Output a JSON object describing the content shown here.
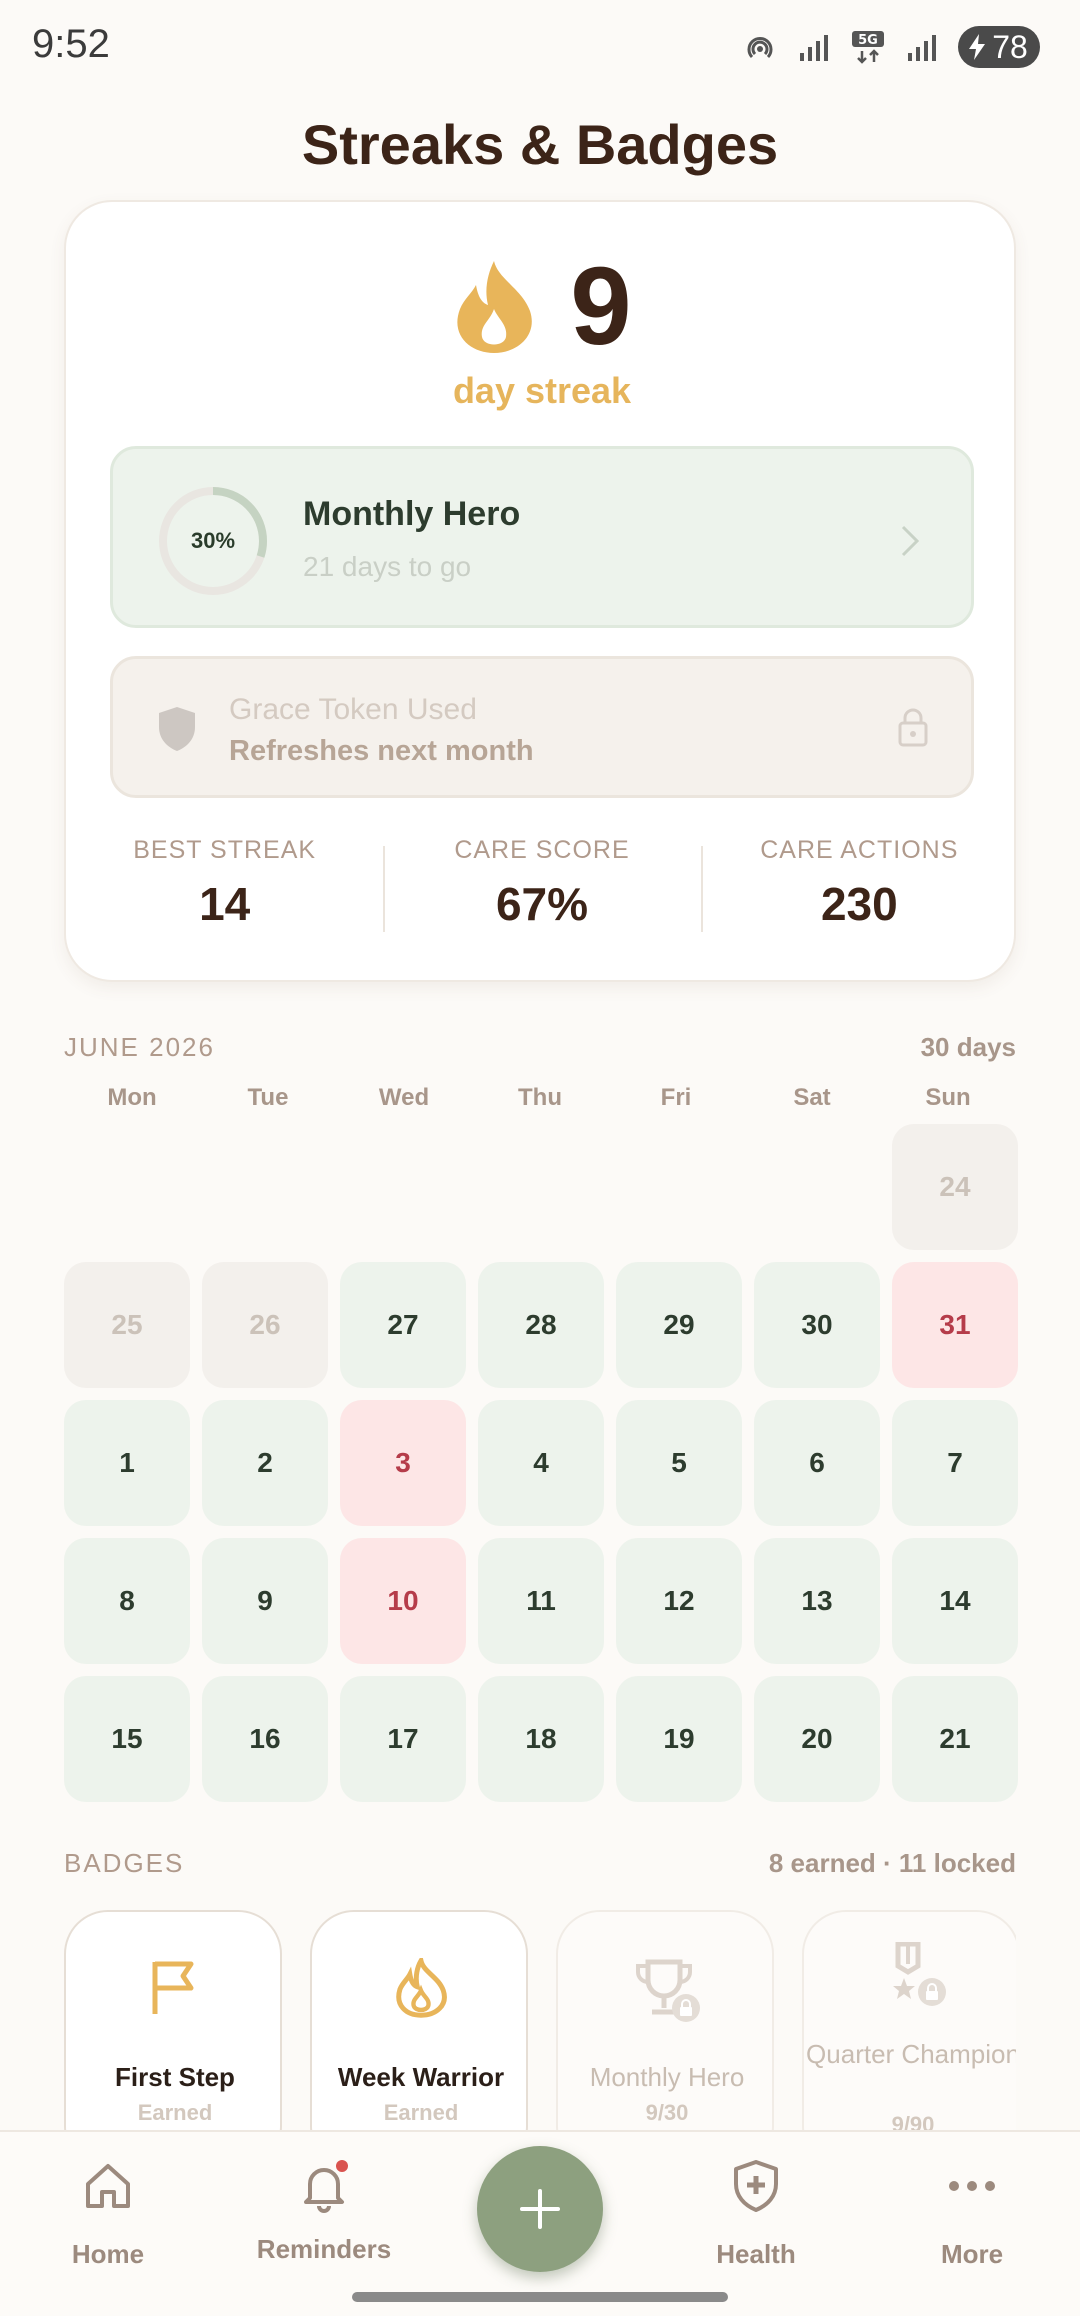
{
  "status_bar": {
    "time": "9:52",
    "battery": "78",
    "network_label": "5G"
  },
  "header": {
    "title": "Streaks & Badges"
  },
  "streak": {
    "value": "9",
    "label": "day streak",
    "flame_color": "#e8b55a"
  },
  "goal": {
    "progress_text": "30%",
    "progress": 0.3,
    "title": "Monthly Hero",
    "subtitle": "21 days to go"
  },
  "grace": {
    "title": "Grace Token Used",
    "subtitle": "Refreshes next month"
  },
  "stats": [
    {
      "label": "BEST STREAK",
      "value": "14"
    },
    {
      "label": "CARE SCORE",
      "value": "67%"
    },
    {
      "label": "CARE ACTIONS",
      "value": "230"
    }
  ],
  "calendar": {
    "month": "JUNE 2026",
    "days_count": "30 days",
    "weekdays": [
      "Mon",
      "Tue",
      "Wed",
      "Thu",
      "Fri",
      "Sat",
      "Sun"
    ],
    "days": [
      {
        "n": "",
        "s": "empty"
      },
      {
        "n": "",
        "s": "empty"
      },
      {
        "n": "",
        "s": "empty"
      },
      {
        "n": "",
        "s": "empty"
      },
      {
        "n": "",
        "s": "empty"
      },
      {
        "n": "",
        "s": "empty"
      },
      {
        "n": "24",
        "s": "future"
      },
      {
        "n": "25",
        "s": "future"
      },
      {
        "n": "26",
        "s": "future"
      },
      {
        "n": "27",
        "s": "done"
      },
      {
        "n": "28",
        "s": "done"
      },
      {
        "n": "29",
        "s": "done"
      },
      {
        "n": "30",
        "s": "done"
      },
      {
        "n": "31",
        "s": "missed"
      },
      {
        "n": "1",
        "s": "done"
      },
      {
        "n": "2",
        "s": "done"
      },
      {
        "n": "3",
        "s": "missed"
      },
      {
        "n": "4",
        "s": "done"
      },
      {
        "n": "5",
        "s": "done"
      },
      {
        "n": "6",
        "s": "done"
      },
      {
        "n": "7",
        "s": "done"
      },
      {
        "n": "8",
        "s": "done"
      },
      {
        "n": "9",
        "s": "done"
      },
      {
        "n": "10",
        "s": "missed"
      },
      {
        "n": "11",
        "s": "done"
      },
      {
        "n": "12",
        "s": "done"
      },
      {
        "n": "13",
        "s": "done"
      },
      {
        "n": "14",
        "s": "done"
      },
      {
        "n": "15",
        "s": "done"
      },
      {
        "n": "16",
        "s": "done"
      },
      {
        "n": "17",
        "s": "done"
      },
      {
        "n": "18",
        "s": "done"
      },
      {
        "n": "19",
        "s": "done"
      },
      {
        "n": "20",
        "s": "done"
      },
      {
        "n": "21",
        "s": "done"
      }
    ]
  },
  "badges": {
    "title": "BADGES",
    "count": "8 earned · 11 locked",
    "items": [
      {
        "name": "First Step",
        "status": "Earned",
        "icon": "flag-icon"
      },
      {
        "name": "Week Warrior",
        "status": "Earned",
        "icon": "flame-icon"
      },
      {
        "name": "Monthly Hero",
        "status": "9/30",
        "icon": "trophy-icon"
      },
      {
        "name": "Quarter Champion",
        "status": "9/90",
        "icon": "medal-icon"
      }
    ]
  },
  "nav": {
    "home": "Home",
    "reminders": "Reminders",
    "health": "Health",
    "more": "More"
  }
}
